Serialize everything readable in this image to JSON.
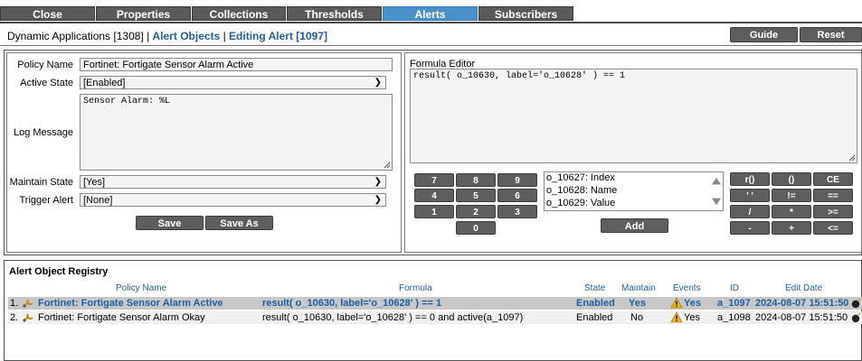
{
  "tabs": [
    {
      "label": "Close",
      "active": false
    },
    {
      "label": "Properties",
      "active": false
    },
    {
      "label": "Collections",
      "active": false
    },
    {
      "label": "Thresholds",
      "active": false
    },
    {
      "label": "Alerts",
      "active": true
    },
    {
      "label": "Subscribers",
      "active": false
    }
  ],
  "breadcrumb": {
    "part1": "Dynamic Applications [1308]",
    "sep": " | ",
    "part2": "Alert Objects",
    "part3": "Editing Alert [1097]"
  },
  "header_buttons": {
    "guide": "Guide",
    "reset": "Reset"
  },
  "form": {
    "policy_name_label": "Policy Name",
    "policy_name_value": "Fortinet: Fortigate Sensor Alarm Active",
    "active_state_label": "Active State",
    "active_state_value": "[Enabled]",
    "log_message_label": "Log Message",
    "log_message_value": "Sensor Alarm: %L",
    "maintain_state_label": "Maintain State",
    "maintain_state_value": "[Yes]",
    "trigger_alert_label": "Trigger Alert",
    "trigger_alert_value": "[None]",
    "save": "Save",
    "save_as": "Save As"
  },
  "formula": {
    "title": "Formula Editor",
    "value": "result( o_10630, label='o_10628' ) == 1",
    "keys": [
      "7",
      "8",
      "9",
      "4",
      "5",
      "6",
      "1",
      "2",
      "3",
      "0"
    ],
    "objects": [
      "o_10627: Index",
      "o_10628: Name",
      "o_10629: Value"
    ],
    "add": "Add",
    "ops": [
      "r()",
      "()",
      "CE",
      "' '",
      "!=",
      "==",
      "/",
      "*",
      ">=",
      "-",
      "+",
      "<="
    ]
  },
  "registry": {
    "title": "Alert Object Registry",
    "columns": [
      "Policy Name",
      "Formula",
      "State",
      "Maintain",
      "Events",
      "ID",
      "Edit Date"
    ],
    "rows": [
      {
        "num": "1.",
        "name": "Fortinet: Fortigate Sensor Alarm Active",
        "formula": "result( o_10630, label='o_10628' ) == 1",
        "state": "Enabled",
        "maintain": "Yes",
        "events": "Yes",
        "id": "a_1097",
        "date": "2024-08-07 15:51:50"
      },
      {
        "num": "2.",
        "name": "Fortinet: Fortigate Sensor Alarm Okay",
        "formula": "result( o_10630, label='o_10628' ) == 0 and active(a_1097)",
        "state": "Enabled",
        "maintain": "No",
        "events": "Yes",
        "id": "a_1098",
        "date": "2024-08-07 15:51:50"
      }
    ]
  },
  "colors": {
    "tab_bg": "#5a5a5a",
    "tab_active": "#4a90c9",
    "link": "#1f5fa0",
    "selected_row": "#c8c8c8"
  }
}
